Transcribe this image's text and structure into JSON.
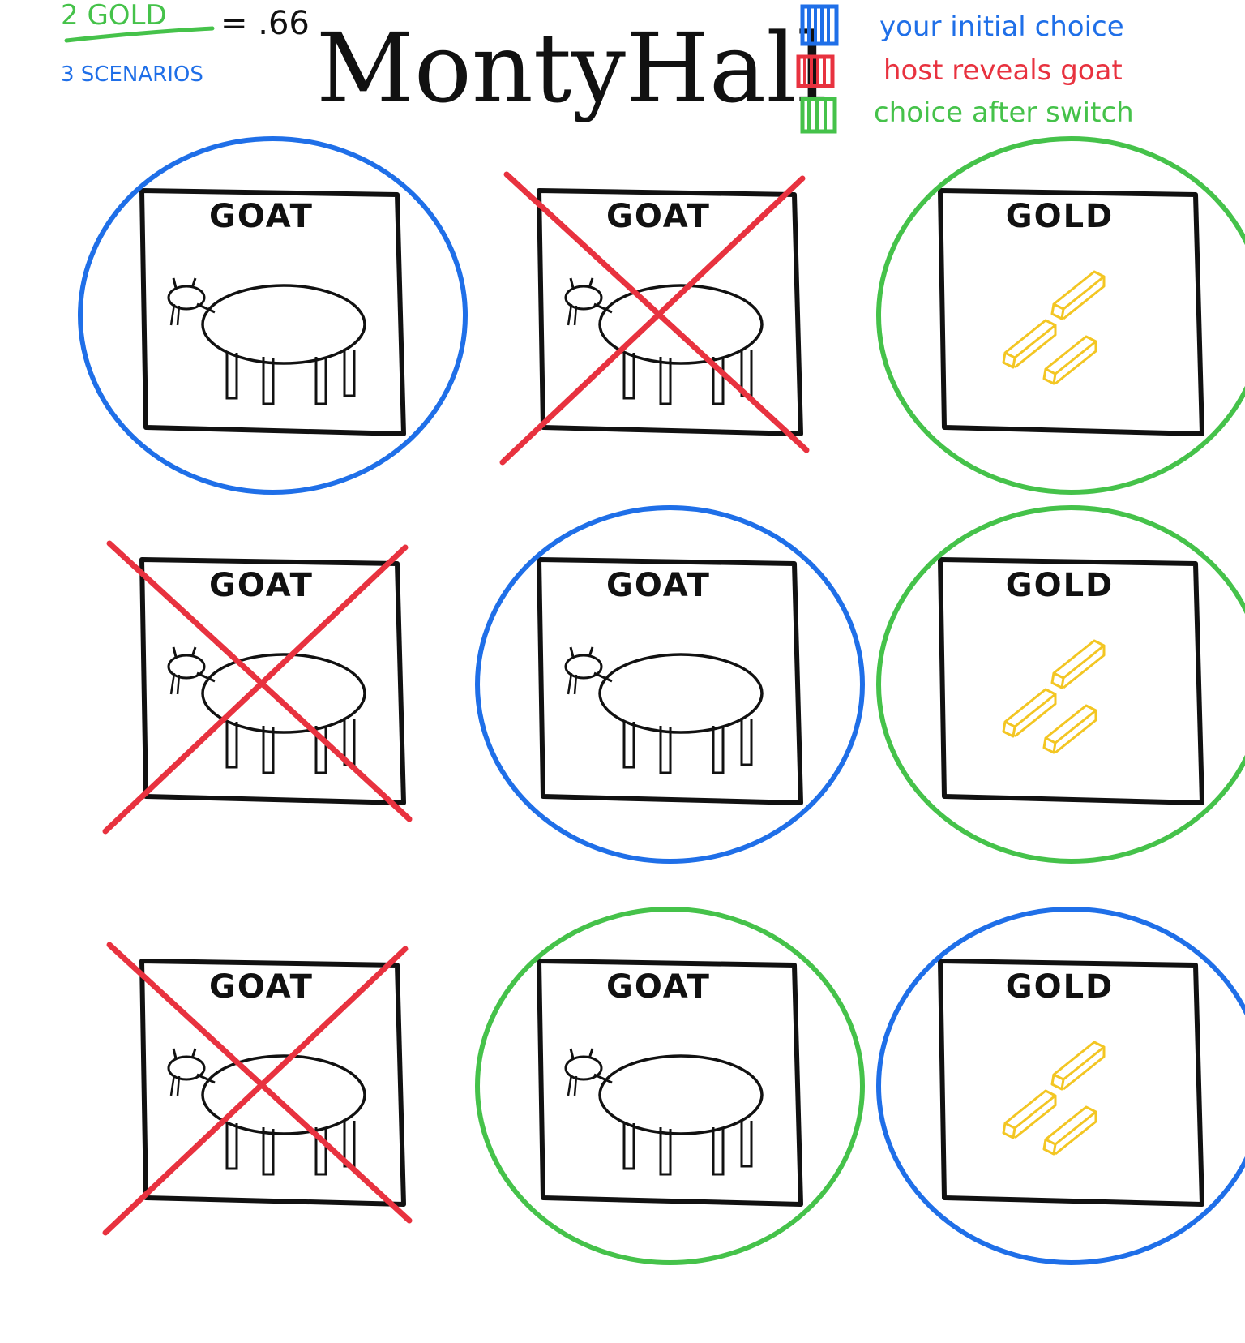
{
  "header": {
    "title": "MontyHall",
    "fraction_numerator": "2 GOLD",
    "fraction_denominator": "3 SCENARIOS",
    "fraction_result": "= .66"
  },
  "legend": {
    "items": [
      {
        "label": "your initial choice",
        "color": "#1f6fe8"
      },
      {
        "label": "host reveals goat",
        "color": "#e8323f"
      },
      {
        "label": "choice after switch",
        "color": "#45c24a"
      }
    ]
  },
  "colors": {
    "initial": "#1f6fe8",
    "reveal": "#e8323f",
    "switch": "#45c24a",
    "gold": "#f3c623",
    "ink": "#111111"
  },
  "scenarios": [
    {
      "doors": [
        {
          "label": "GOAT",
          "content": "goat",
          "mark": "initial"
        },
        {
          "label": "GOAT",
          "content": "goat",
          "mark": "reveal"
        },
        {
          "label": "GOLD",
          "content": "gold",
          "mark": "switch"
        }
      ]
    },
    {
      "doors": [
        {
          "label": "GOAT",
          "content": "goat",
          "mark": "reveal"
        },
        {
          "label": "GOAT",
          "content": "goat",
          "mark": "initial"
        },
        {
          "label": "GOLD",
          "content": "gold",
          "mark": "switch"
        }
      ]
    },
    {
      "doors": [
        {
          "label": "GOAT",
          "content": "goat",
          "mark": "reveal"
        },
        {
          "label": "GOAT",
          "content": "goat",
          "mark": "switch"
        },
        {
          "label": "GOLD",
          "content": "gold",
          "mark": "initial"
        }
      ]
    }
  ]
}
